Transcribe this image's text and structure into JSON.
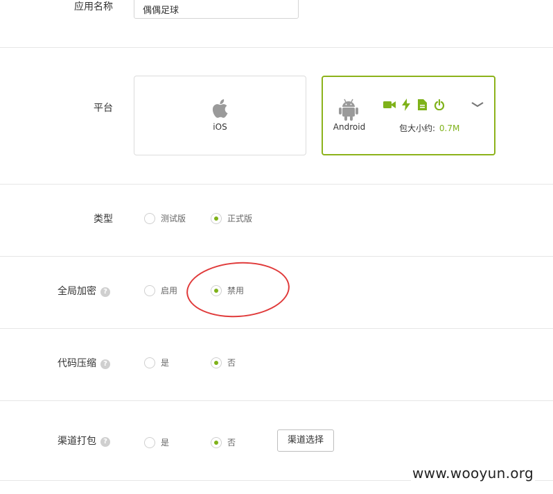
{
  "app_name": {
    "label": "应用名称",
    "value": "偶偶足球"
  },
  "platform": {
    "label": "平台",
    "ios": {
      "name": "iOS",
      "icon": "apple-icon"
    },
    "android": {
      "name": "Android",
      "icon": "android-icon",
      "size_label": "包大小约:",
      "size_value": "0.7M"
    }
  },
  "type": {
    "label": "类型",
    "options": [
      "测试版",
      "正式版"
    ],
    "selected": "正式版"
  },
  "global_encryption": {
    "label": "全局加密",
    "help": "?",
    "options": [
      "启用",
      "禁用"
    ],
    "selected": "禁用"
  },
  "code_compression": {
    "label": "代码压缩",
    "help": "?",
    "options": [
      "是",
      "否"
    ],
    "selected": "否"
  },
  "channel_pack": {
    "label": "渠道打包",
    "help": "?",
    "options": [
      "是",
      "否"
    ],
    "selected": "否",
    "button": "渠道选择"
  },
  "watermark": "www.wooyun.org",
  "colors": {
    "accent": "#7fb21a",
    "android_border": "#8cb21a",
    "annotation": "#e03a3a"
  }
}
